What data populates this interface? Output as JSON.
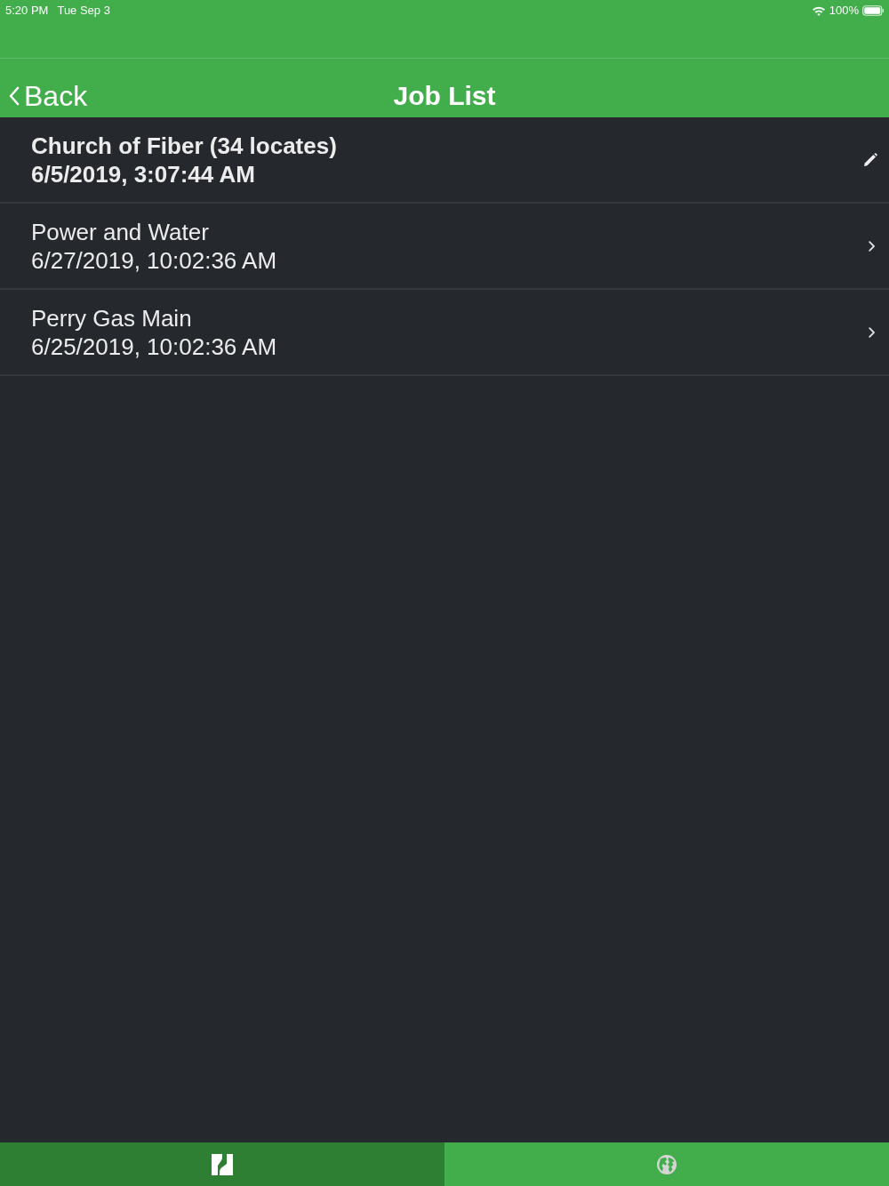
{
  "status_bar": {
    "time": "5:20 PM",
    "date": "Tue Sep 3",
    "battery": "100%"
  },
  "nav_bar": {
    "back": "Back",
    "title": "Job List"
  },
  "jobs": [
    {
      "name": "Church of Fiber (34 locates)",
      "date": "6/5/2019, 3:07:44 AM",
      "selected": true
    },
    {
      "name": "Power and Water",
      "date": "6/27/2019, 10:02:36 AM",
      "selected": false
    },
    {
      "name": "Perry Gas Main",
      "date": "6/25/2019, 10:02:36 AM",
      "selected": false
    }
  ],
  "tab_bar": [
    {
      "kind": "logo",
      "selected": true
    },
    {
      "kind": "globe",
      "selected": false
    }
  ]
}
